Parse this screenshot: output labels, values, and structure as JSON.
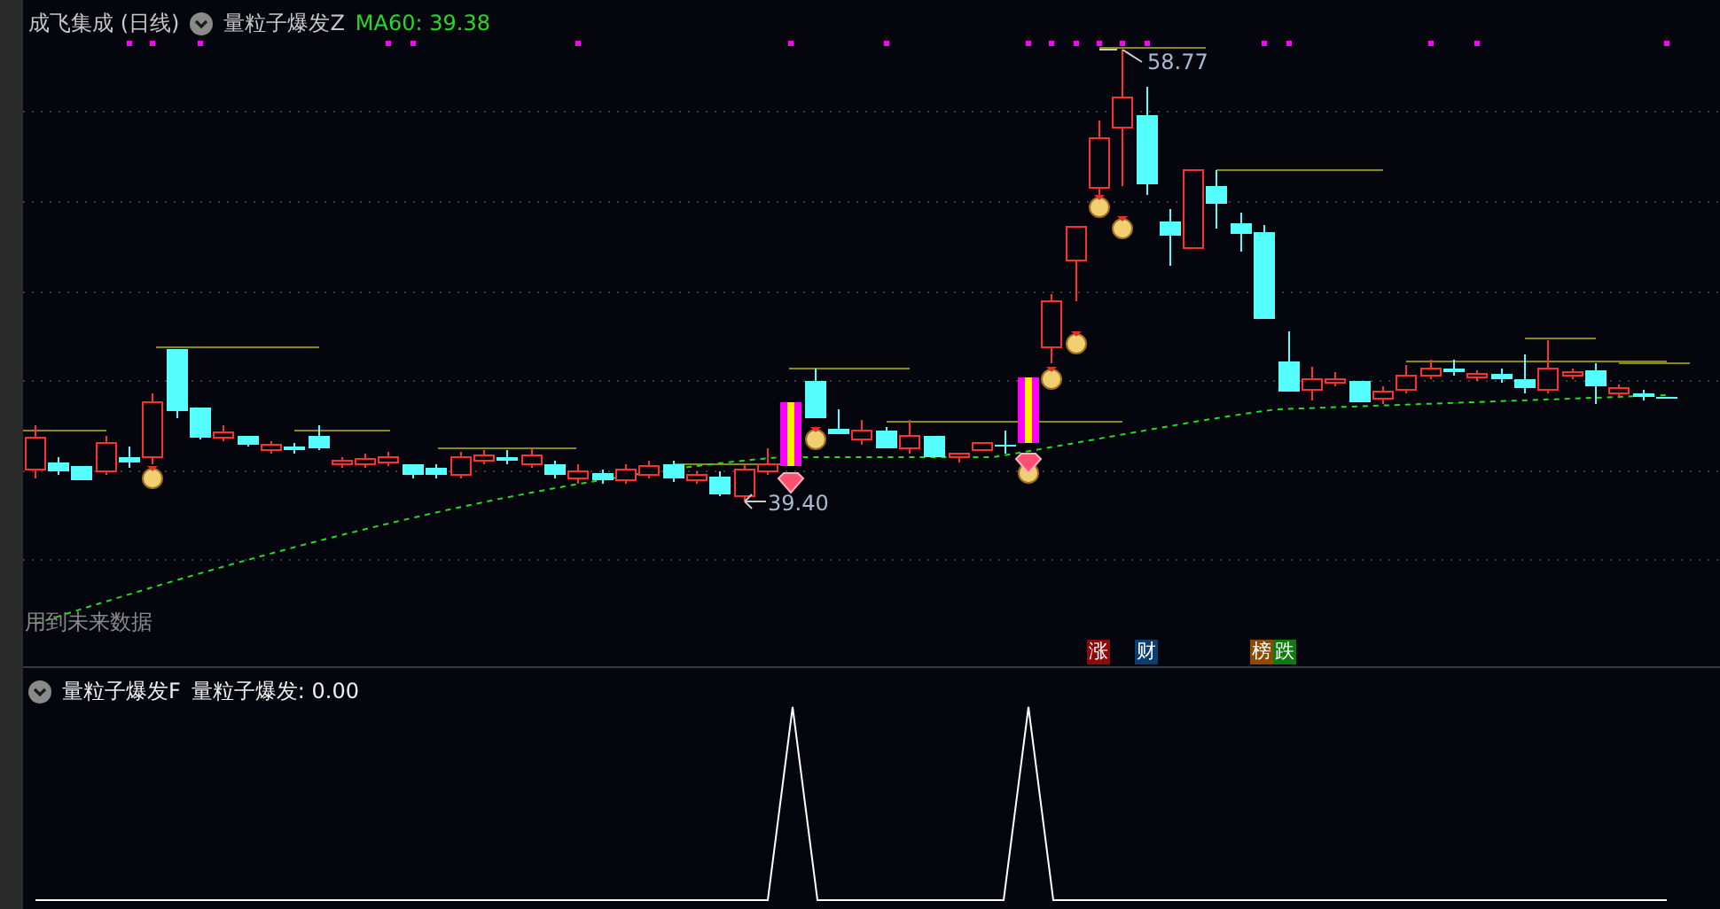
{
  "main_panel": {
    "stock_title": "成飞集成 (日线)",
    "indicator_name": "量粒子爆发Z",
    "ma_reading": "MA60: 39.38",
    "high_label": "58.77",
    "low_label": "39.40",
    "warning": "用到未来数据",
    "signal_tags": [
      {
        "text": "涨",
        "color": "#8b0a0a"
      },
      {
        "text": "财",
        "color": "#0c3c70"
      },
      {
        "text": "榜",
        "color": "#8c4a00"
      },
      {
        "text": "跌",
        "color": "#0f7a10"
      }
    ]
  },
  "sub_panel": {
    "indicator_name": "量粒子爆发F",
    "reading": "量粒子爆发: 0.00"
  }
}
